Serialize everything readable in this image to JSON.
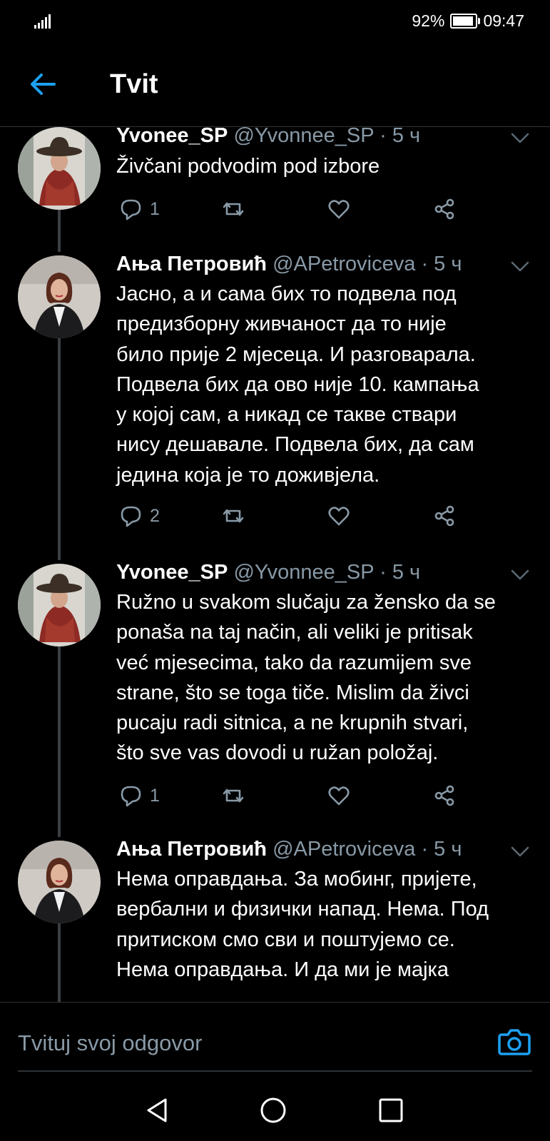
{
  "status_bar": {
    "battery_percent": "92%",
    "battery_level": 0.92,
    "time": "09:47"
  },
  "header": {
    "title": "Tvit"
  },
  "tweets": [
    {
      "name": "Yvonee_SP",
      "handle": "@Yvonnee_SP",
      "time": "· 5 ч",
      "avatar": "woman-in-hat",
      "lines": [
        "Živčani podvodim pod izbore"
      ],
      "reply_count": "1"
    },
    {
      "name": "Ања Петровић",
      "handle": "@APetroviceva",
      "time": "· 5 ч",
      "avatar": "woman-in-blazer",
      "lines": [
        "Јасно, а и сама бих то подвела под",
        "предизборну живчаност да то није",
        "било прије 2 мјесеца. И разговарала.",
        "Подвела бих да ово није 10. кампања",
        "у којој сам, а никад се такве ствари",
        "нису дешавале. Подвела бих, да сам",
        "једина која је то доживјела."
      ],
      "reply_count": "2"
    },
    {
      "name": "Yvonee_SP",
      "handle": "@Yvonnee_SP",
      "time": "· 5 ч",
      "avatar": "woman-in-hat",
      "lines": [
        "Ružno u svakom slučaju za žensko da se",
        "ponaša na taj način, ali veliki je pritisak",
        "već mjesecima, tako da razumijem sve",
        "strane, što se toga tiče. Mislim da živci",
        "pucaju radi sitnica, a ne krupnih stvari,",
        "što sve vas dovodi u ružan položaj."
      ],
      "reply_count": "1"
    },
    {
      "name": "Ања Петровић",
      "handle": "@APetroviceva",
      "time": "· 5 ч",
      "avatar": "woman-in-blazer",
      "lines": [
        "Нема оправдања. За мобинг, пријете,",
        "вербални и физички напад. Нема. Под",
        "притиском смо сви и поштујемо се.",
        "Нема оправдања. И да ми је мајка"
      ],
      "reply_count": ""
    }
  ],
  "reply_box": {
    "placeholder": "Tvituj svoj odgovor"
  },
  "icons": {
    "back": "arrow-left-icon",
    "reply": "reply-icon",
    "retweet": "retweet-icon",
    "like": "heart-icon",
    "share": "share-icon",
    "camera": "camera-icon",
    "nav_back": "triangle-back-icon",
    "nav_home": "circle-home-icon",
    "nav_recents": "square-recents-icon"
  },
  "colors": {
    "accent": "#1da1f2",
    "background": "#000000",
    "muted": "#8899a6",
    "divider": "#2f3336"
  }
}
